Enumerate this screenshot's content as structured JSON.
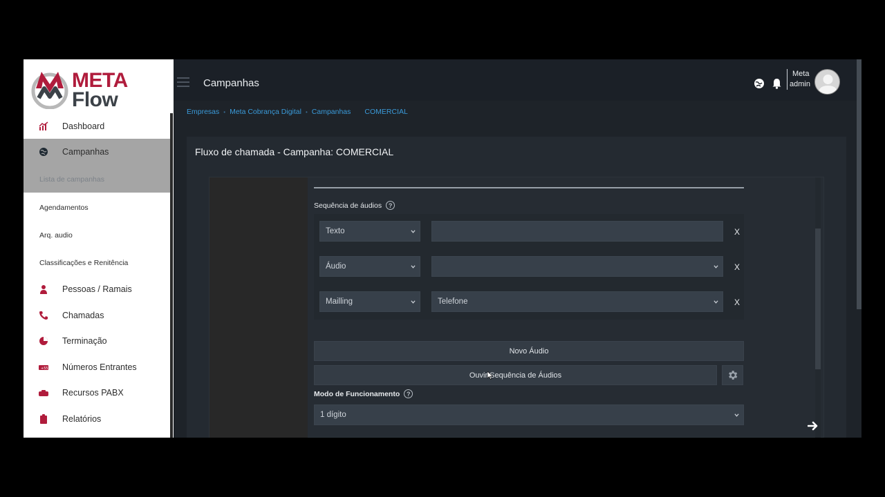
{
  "logo": {
    "line1": "META",
    "line2": "Flow"
  },
  "sidebar": {
    "items": [
      {
        "label": "Dashboard",
        "icon": "chart-icon"
      },
      {
        "label": "Campanhas",
        "icon": "globe-icon"
      },
      {
        "label": "Lista de campanhas",
        "icon": ""
      },
      {
        "label": "Agendamentos",
        "icon": ""
      },
      {
        "label": "Arq. audio",
        "icon": ""
      },
      {
        "label": "Classificações e Renitência",
        "icon": ""
      },
      {
        "label": "Pessoas / Ramais",
        "icon": "person-icon"
      },
      {
        "label": "Chamadas",
        "icon": "phone-icon"
      },
      {
        "label": "Terminação",
        "icon": "pie-icon"
      },
      {
        "label": "Números Entrantes",
        "icon": "money-icon"
      },
      {
        "label": "Recursos PABX",
        "icon": "badge-icon"
      },
      {
        "label": "Relatórios",
        "icon": "clipboard-icon"
      }
    ]
  },
  "header": {
    "title": "Campanhas",
    "user_line1": "Meta",
    "user_line2": "admin"
  },
  "breadcrumb": {
    "items": [
      "Empresas",
      "Meta Cobrança Digital",
      "Campanhas"
    ],
    "current": "COMERCIAL"
  },
  "card": {
    "title": "Fluxo de chamada - Campanha: COMERCIAL",
    "sequence_label": "Sequência de áudios",
    "rows": [
      {
        "type": "Texto",
        "value": "",
        "remove": "X"
      },
      {
        "type": "Áudio",
        "value": "",
        "remove": "X"
      },
      {
        "type": "Mailling",
        "value": "Telefone",
        "remove": "X"
      }
    ],
    "new_audio_button": "Novo Áudio",
    "play_sequence_button": "Ouvir Sequência de Áudios",
    "mode_label": "Modo de Funcionamento",
    "mode_value": "1 dígito"
  },
  "colors": {
    "brand_red": "#b01c3c",
    "link_blue": "#3a9ad9",
    "dark_bg": "#1e2329"
  }
}
